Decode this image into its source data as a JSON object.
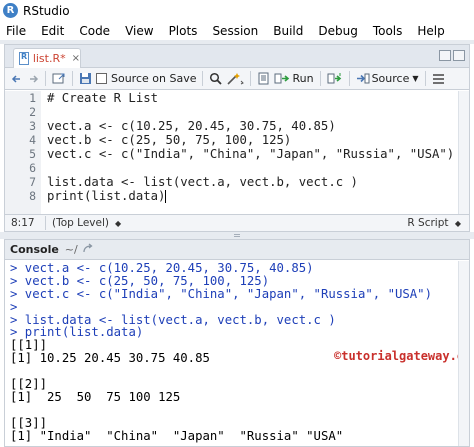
{
  "window": {
    "title": "RStudio"
  },
  "menu": [
    "File",
    "Edit",
    "Code",
    "View",
    "Plots",
    "Session",
    "Build",
    "Debug",
    "Tools",
    "Help"
  ],
  "editor": {
    "tab_label": "list.R*",
    "tab_close": "×",
    "toolbar": {
      "source_on_save": "Source on Save",
      "run": "Run",
      "source": "Source"
    },
    "line_numbers": [
      "1",
      "2",
      "3",
      "4",
      "5",
      "6",
      "7",
      "8"
    ],
    "code": [
      "# Create R List",
      "",
      "vect.a <- c(10.25, 20.45, 30.75, 40.85)",
      "vect.b <- c(25, 50, 75, 100, 125)",
      "vect.c <- c(\"India\", \"China\", \"Japan\", \"Russia\", \"USA\")",
      "",
      "list.data <- list(vect.a, vect.b, vect.c )",
      "print(list.data)"
    ],
    "status": {
      "position": "8:17",
      "scope": "(Top Level)",
      "file_type": "R Script"
    }
  },
  "console": {
    "title": "Console",
    "path": "~/",
    "lines": [
      {
        "type": "input",
        "text": "> vect.a <- c(10.25, 20.45, 30.75, 40.85)"
      },
      {
        "type": "input",
        "text": "> vect.b <- c(25, 50, 75, 100, 125)"
      },
      {
        "type": "input",
        "text": "> vect.c <- c(\"India\", \"China\", \"Japan\", \"Russia\", \"USA\")"
      },
      {
        "type": "input",
        "text": ">"
      },
      {
        "type": "input",
        "text": "> list.data <- list(vect.a, vect.b, vect.c )"
      },
      {
        "type": "input",
        "text": "> print(list.data)"
      },
      {
        "type": "output",
        "text": "[[1]]"
      },
      {
        "type": "output",
        "text": "[1] 10.25 20.45 30.75 40.85"
      },
      {
        "type": "output",
        "text": ""
      },
      {
        "type": "output",
        "text": "[[2]]"
      },
      {
        "type": "output",
        "text": "[1]  25  50  75 100 125"
      },
      {
        "type": "output",
        "text": ""
      },
      {
        "type": "output",
        "text": "[[3]]"
      },
      {
        "type": "output",
        "text": "[1] \"India\"  \"China\"  \"Japan\"  \"Russia\" \"USA\""
      }
    ],
    "watermark": "©tutorialgateway.org"
  },
  "colors": {
    "console_input": "#1e3fb8",
    "comment": "#4b72c8",
    "watermark": "#c9302c",
    "modified_tab": "#c43"
  }
}
